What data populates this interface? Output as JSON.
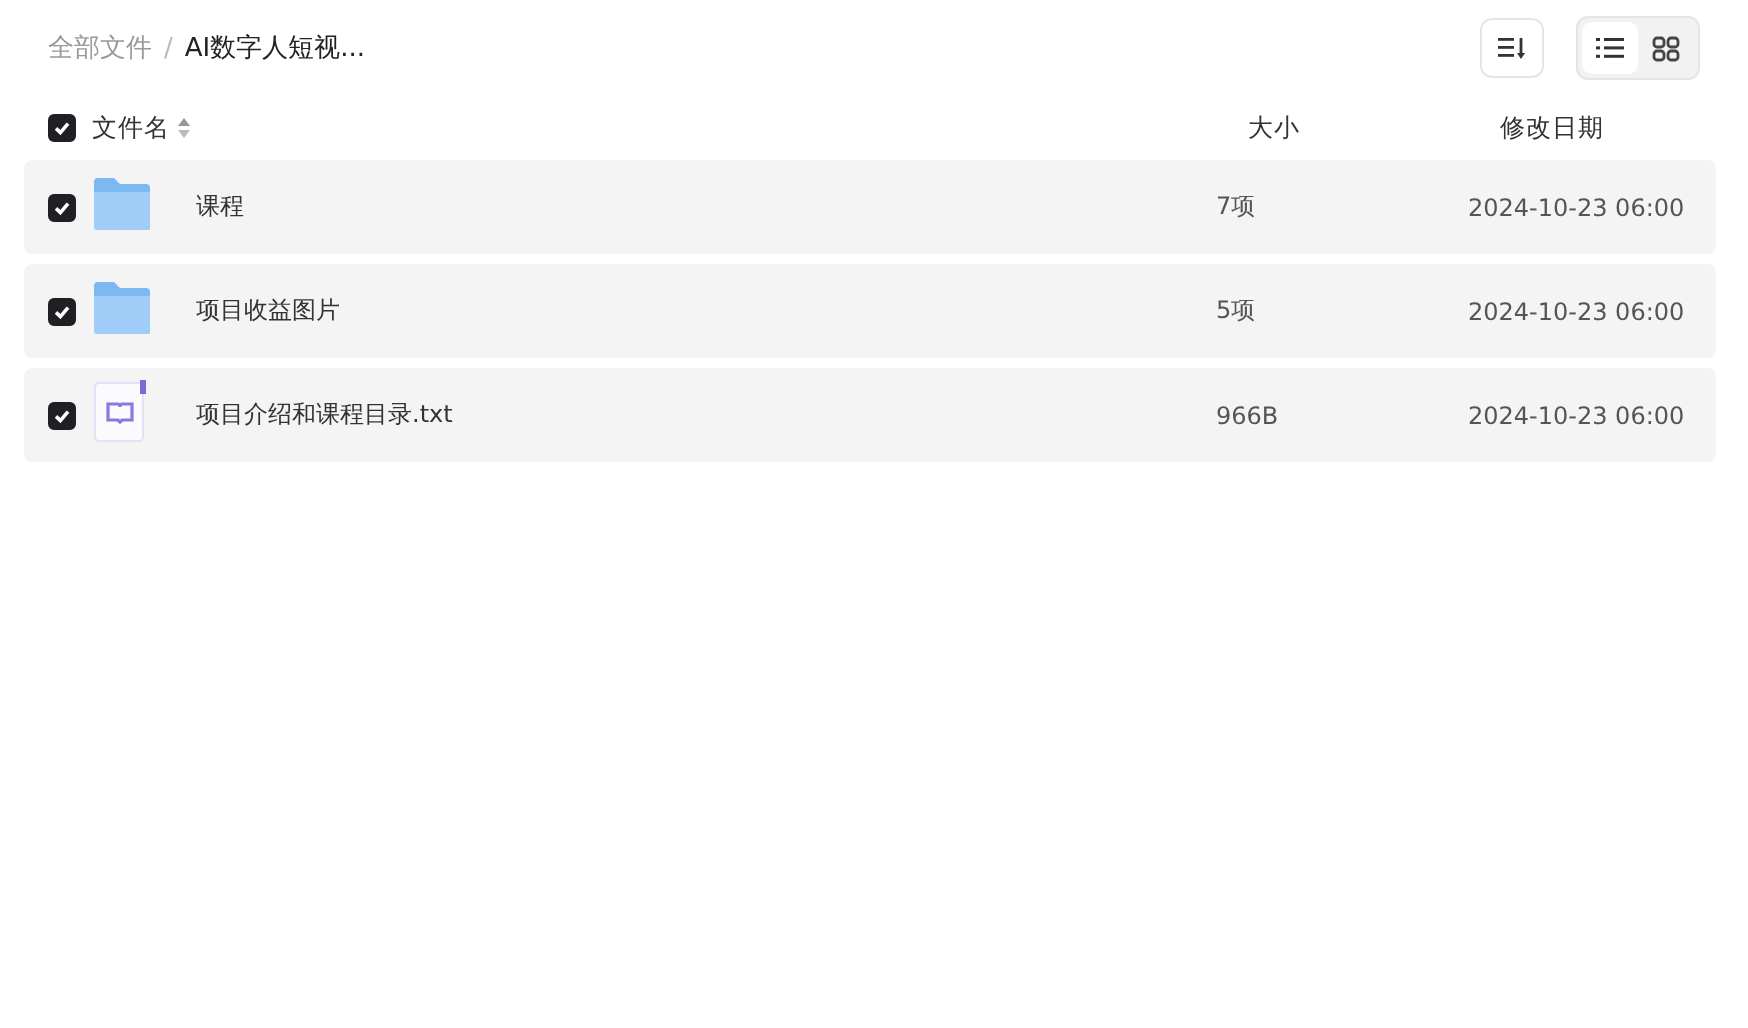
{
  "breadcrumb_separator": "/",
  "breadcrumb": [
    {
      "label": "全部文件",
      "current": false
    },
    {
      "label": "AI数字人短视...",
      "current": true
    }
  ],
  "view_modes": [
    {
      "kind": "list",
      "selected": true
    },
    {
      "kind": "grid",
      "selected": false
    }
  ],
  "header": {
    "checked": true,
    "name": "文件名",
    "size": "大小",
    "date": "修改日期"
  },
  "files": [
    {
      "kind": "folder",
      "checked": true,
      "name": "课程",
      "size": "7项",
      "date": "2024-10-23 06:00"
    },
    {
      "kind": "folder",
      "checked": true,
      "name": "项目收益图片",
      "size": "5项",
      "date": "2024-10-23 06:00"
    },
    {
      "kind": "text",
      "checked": true,
      "name": "项目介绍和课程目录.txt",
      "size": "966B",
      "date": "2024-10-23 06:00"
    }
  ]
}
